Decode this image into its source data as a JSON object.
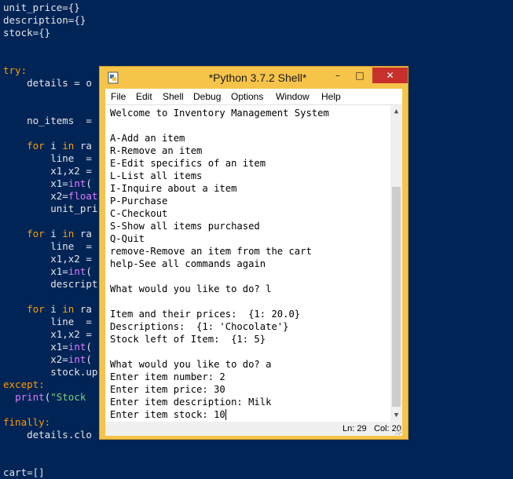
{
  "editor": {
    "lines": [
      {
        "parts": [
          [
            "unit_price={}",
            ""
          ]
        ]
      },
      {
        "parts": [
          [
            "description={}",
            ""
          ]
        ]
      },
      {
        "parts": [
          [
            "stock={}",
            ""
          ]
        ]
      },
      {
        "parts": [
          [
            "try:",
            "kw"
          ]
        ]
      },
      {
        "parts": [
          [
            "    details = o",
            ""
          ]
        ]
      },
      {
        "parts": [
          [
            "    no_items  =",
            ""
          ]
        ]
      },
      {
        "parts": [
          [
            "    ",
            ""
          ],
          [
            "for",
            "kw"
          ],
          [
            " i ",
            ""
          ],
          [
            "in",
            "kw"
          ],
          [
            " ra",
            ""
          ]
        ]
      },
      {
        "parts": [
          [
            "        line  =",
            ""
          ]
        ]
      },
      {
        "parts": [
          [
            "        x1,x2 =",
            ""
          ]
        ]
      },
      {
        "parts": [
          [
            "        x1=",
            ""
          ],
          [
            "int",
            "bi"
          ],
          [
            "(",
            ""
          ]
        ]
      },
      {
        "parts": [
          [
            "        x2=",
            ""
          ],
          [
            "float",
            "bi"
          ]
        ]
      },
      {
        "parts": [
          [
            "        unit_pri",
            ""
          ]
        ]
      },
      {
        "parts": [
          [
            "    ",
            ""
          ],
          [
            "for",
            "kw"
          ],
          [
            " i ",
            ""
          ],
          [
            "in",
            "kw"
          ],
          [
            " ra",
            ""
          ]
        ]
      },
      {
        "parts": [
          [
            "        line  =",
            ""
          ]
        ]
      },
      {
        "parts": [
          [
            "        x1,x2 =",
            ""
          ]
        ]
      },
      {
        "parts": [
          [
            "        x1=",
            ""
          ],
          [
            "int",
            "bi"
          ],
          [
            "(",
            ""
          ]
        ]
      },
      {
        "parts": [
          [
            "        descript",
            ""
          ]
        ]
      },
      {
        "parts": [
          [
            "    ",
            ""
          ],
          [
            "for",
            "kw"
          ],
          [
            " i ",
            ""
          ],
          [
            "in",
            "kw"
          ],
          [
            " ra",
            ""
          ]
        ]
      },
      {
        "parts": [
          [
            "        line  =",
            ""
          ]
        ]
      },
      {
        "parts": [
          [
            "        x1,x2 =",
            ""
          ]
        ]
      },
      {
        "parts": [
          [
            "        x1=",
            ""
          ],
          [
            "int",
            "bi"
          ],
          [
            "(",
            ""
          ]
        ]
      },
      {
        "parts": [
          [
            "        x2=",
            ""
          ],
          [
            "int",
            "bi"
          ],
          [
            "(",
            ""
          ]
        ]
      },
      {
        "parts": [
          [
            "        stock.up",
            ""
          ]
        ]
      },
      {
        "parts": [
          [
            "except:",
            "kw"
          ]
        ]
      },
      {
        "parts": [
          [
            "  ",
            ""
          ],
          [
            "print",
            "bi"
          ],
          [
            "(",
            ""
          ],
          [
            "\"Stock ",
            "st"
          ]
        ]
      },
      {
        "parts": [
          [
            "finally:",
            "kw"
          ]
        ]
      },
      {
        "parts": [
          [
            "    details.clo",
            ""
          ]
        ]
      },
      {
        "parts": [
          [
            "cart=[]",
            ""
          ]
        ]
      }
    ]
  },
  "shell": {
    "title": "*Python 3.7.2 Shell*",
    "minimize": "–",
    "maximize": "□",
    "close": "✕",
    "menu": [
      "File",
      "Edit",
      "Shell",
      "Debug",
      "Options",
      "Window",
      "Help"
    ],
    "output": [
      "Welcome to Inventory Management System",
      "",
      "A-Add an item",
      "R-Remove an item",
      "E-Edit specifics of an item",
      "L-List all items",
      "I-Inquire about a item",
      "P-Purchase",
      "C-Checkout",
      "S-Show all items purchased",
      "Q-Quit",
      "remove-Remove an item from the cart",
      "help-See all commands again",
      "",
      "What would you like to do? l",
      "",
      "Item and their prices:  {1: 20.0}",
      "Descriptions:  {1: 'Chocolate'}",
      "Stock left of Item:  {1: 5}",
      "",
      "What would you like to do? a",
      "Enter item number: 2",
      "Enter item price: 30",
      "Enter item description: Milk",
      "Enter item stock: 10"
    ],
    "status": {
      "ln": "Ln: 29",
      "col": "Col: 20"
    },
    "icons": {
      "app": "python-idle-icon",
      "up": "scroll-up-arrow",
      "down": "scroll-down-arrow"
    }
  }
}
